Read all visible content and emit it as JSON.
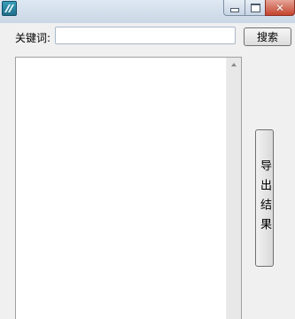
{
  "titlebar": {
    "icon": "app-icon",
    "minimize_icon": "minimize-icon",
    "maximize_icon": "maximize-icon",
    "close_glyph": "✕"
  },
  "search": {
    "label": "关键词:",
    "input_value": "",
    "button_label": "搜索"
  },
  "results": {
    "items": []
  },
  "export": {
    "button_label": "导出结果"
  },
  "colors": {
    "background": "#f0f0f0",
    "close_button": "#c5442d",
    "input_border": "#a9b8c8"
  }
}
